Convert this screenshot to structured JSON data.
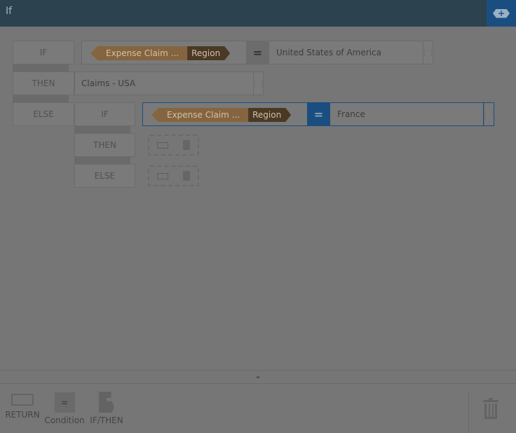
{
  "header": {
    "title": "If",
    "add_icon": "add-badge-icon"
  },
  "rule1": {
    "if_label": "IF",
    "field_entity": "Expense Claim ...",
    "field_name": "Region",
    "operator": "=",
    "value": "United States of America",
    "then_label": "THEN",
    "then_value": "Claims - USA",
    "else_label": "ELSE"
  },
  "rule2": {
    "if_label": "IF",
    "field_entity": "Expense Claim ...",
    "field_name": "Region",
    "operator": "=",
    "value": "France",
    "then_label": "THEN",
    "else_label": "ELSE"
  },
  "toolbar": {
    "return_label": "RETURN",
    "condition_label": "Condition",
    "condition_symbol": "=",
    "ifthen_label": "IF/THEN"
  },
  "colors": {
    "header": "#2c424f",
    "accent": "#1b4e80",
    "pill": "#85653f"
  }
}
